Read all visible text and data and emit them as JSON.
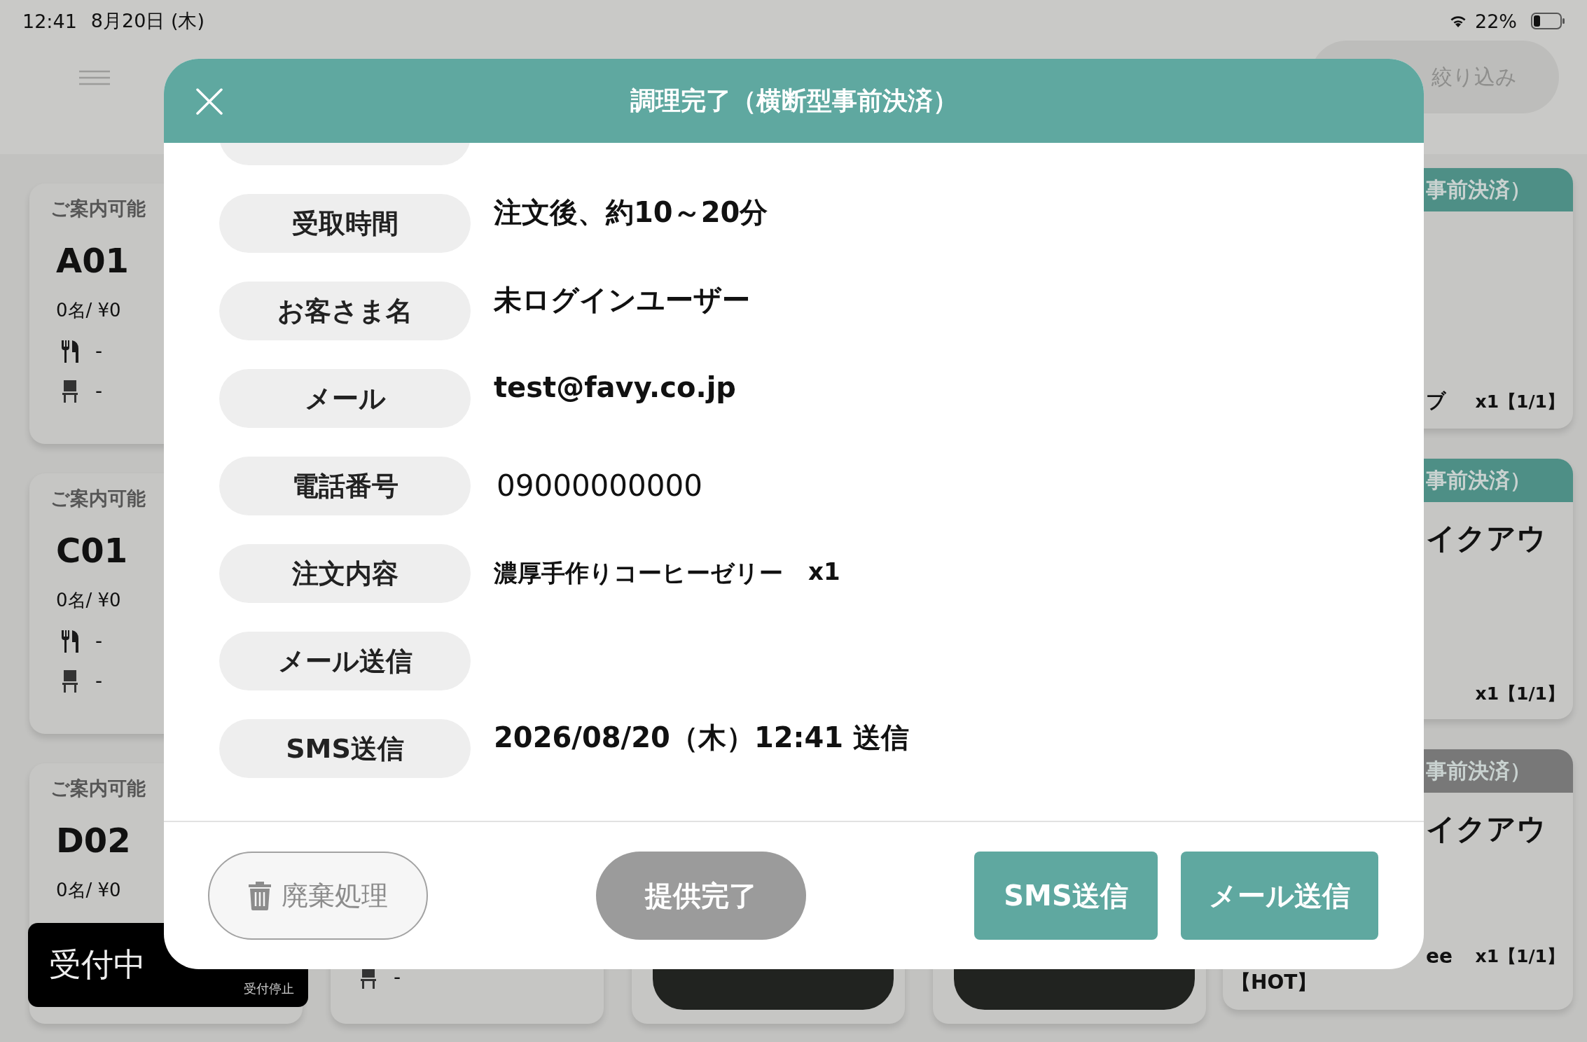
{
  "status_bar": {
    "time": "12:41",
    "date": "8月20日 (木)",
    "battery": "22%"
  },
  "header": {
    "filter_button": "絞り込み"
  },
  "left_cards": [
    {
      "status": "ご案内可能",
      "name": "A01",
      "guests": "0名/ ¥0",
      "utensils": "-",
      "seat": "-"
    },
    {
      "status": "ご案内可能",
      "name": "C01",
      "guests": "0名/ ¥0",
      "utensils": "-",
      "seat": "-"
    },
    {
      "status": "ご案内可能",
      "name": "D02",
      "guests": "0名/ ¥0"
    }
  ],
  "bottom_cards": [
    {
      "kind": "seat",
      "seat": "-"
    },
    {
      "kind": "action"
    },
    {
      "kind": "action"
    }
  ],
  "reception": {
    "label": "受付中",
    "stop_button": "受付停止"
  },
  "order_cards": [
    {
      "color": "#4e8f86",
      "header": "事前決済）",
      "item": "ブ",
      "quantity": "x1【1/1】"
    },
    {
      "color": "#4e8f86",
      "header": "事前決済）",
      "title": "イクアウ",
      "quantity": "x1【1/1】"
    },
    {
      "color": "#787878",
      "header": "事前決済）",
      "title": "イクアウ",
      "item": "ee",
      "quantity": "x1【1/1】",
      "note": "【HOT】"
    }
  ],
  "modal": {
    "title": "調理完了（横断型事前決済）",
    "rows": [
      {
        "label": "受取時間",
        "kind": "bold",
        "value": "注文後、約10～20分"
      },
      {
        "label": "お客さま名",
        "kind": "bold",
        "value": "未ログインユーザー"
      },
      {
        "label": "メール",
        "kind": "bold",
        "value": "test@favy.co.jp"
      },
      {
        "label": "電話番号",
        "kind": "plain",
        "value": "09000000000"
      },
      {
        "label": "注文内容",
        "kind": "order",
        "value": "濃厚手作りコーヒーゼリー",
        "quantity": "x1"
      },
      {
        "label": "メール送信",
        "kind": "empty"
      },
      {
        "label": "SMS送信",
        "kind": "bold",
        "value": "2026/08/20（木）12:41 送信"
      }
    ],
    "buttons": [
      {
        "kind": "discard",
        "label": "廃棄処理"
      },
      {
        "kind": "complete",
        "label": "提供完了",
        "disabled": true
      },
      {
        "kind": "send",
        "label": "SMS送信"
      },
      {
        "kind": "send",
        "label": "メール送信"
      }
    ]
  }
}
